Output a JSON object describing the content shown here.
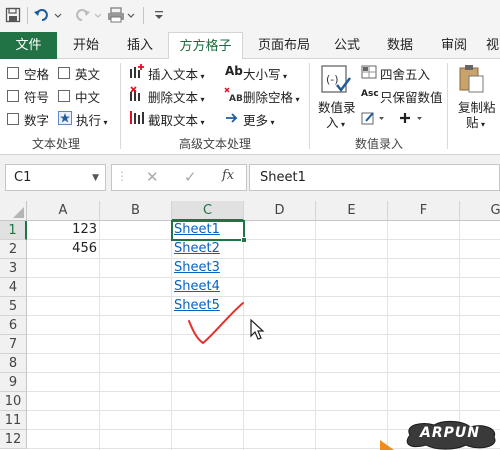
{
  "qat": {
    "icons": [
      "save-icon",
      "undo-icon",
      "redo-icon",
      "print-icon",
      "customize-icon"
    ]
  },
  "tabs": [
    {
      "label": "文件",
      "kind": "file"
    },
    {
      "label": "开始"
    },
    {
      "label": "插入"
    },
    {
      "label": "方方格子",
      "active": true
    },
    {
      "label": "页面布局"
    },
    {
      "label": "公式"
    },
    {
      "label": "数据"
    },
    {
      "label": "审阅"
    },
    {
      "label": "视"
    }
  ],
  "ribbon": {
    "text_processing": {
      "checkboxes": [
        "空格",
        "英文",
        "符号",
        "中文",
        "数字"
      ],
      "execute_label": "执行",
      "group_label": "文本处理"
    },
    "advanced_text": {
      "insert_text": "插入文本",
      "delete_text": "删除文本",
      "extract_text": "截取文本",
      "case_label": "大小写",
      "delete_space": "删除空格",
      "more_label": "更多",
      "group_label": "高级文本处理"
    },
    "number_entry": {
      "big_button_line1": "数值录",
      "big_button_line2": "入",
      "round_label": "四舍五入",
      "keep_value_label": "只保留数值",
      "group_label": "数值录入"
    },
    "clipboard": {
      "line1": "复制粘",
      "line2": "贴"
    }
  },
  "formula_bar": {
    "name_box": "C1",
    "fx": "fx",
    "value": "Sheet1"
  },
  "columns": [
    "A",
    "B",
    "C",
    "D",
    "E",
    "F",
    "G"
  ],
  "selected_column": "C",
  "rows": [
    "1",
    "2",
    "3",
    "4",
    "5",
    "6",
    "7",
    "8",
    "9",
    "10",
    "11",
    "12"
  ],
  "selected_row": "1",
  "cells": {
    "A1": "123",
    "A2": "456",
    "C": [
      "Sheet1",
      "Sheet2",
      "Sheet3",
      "Sheet4",
      "Sheet5"
    ]
  },
  "watermark": "ARPUN",
  "colors": {
    "excel_green": "#217346",
    "link_blue": "#0563c1",
    "checkmark_red": "#e0332b"
  }
}
